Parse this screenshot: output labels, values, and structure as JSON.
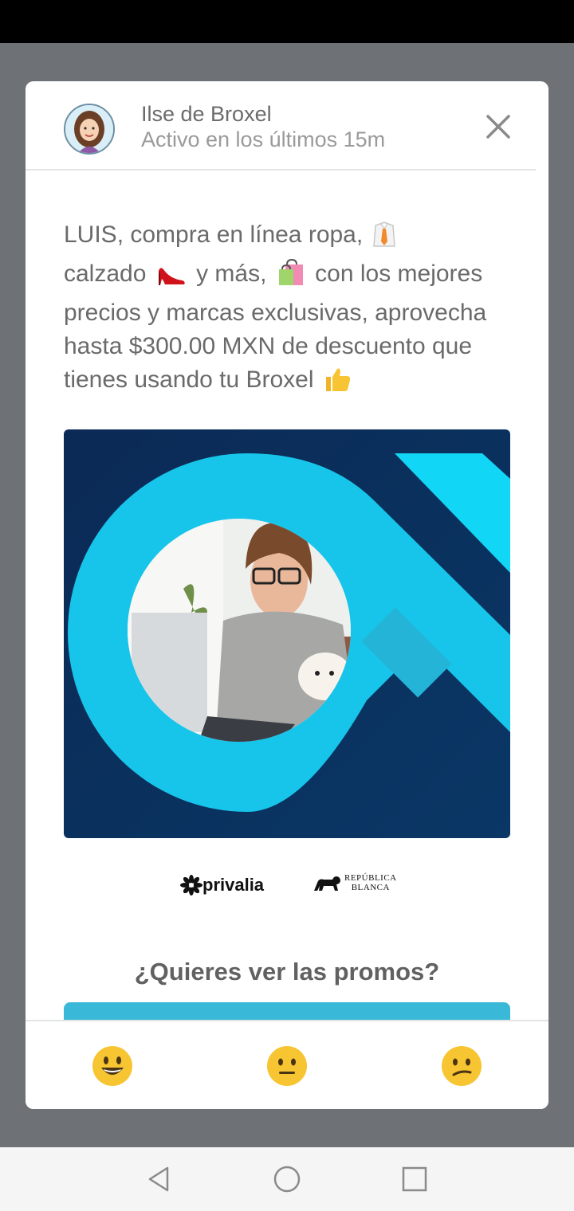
{
  "sender": {
    "name": "Ilse de Broxel",
    "status": "Activo en los últimos 15m"
  },
  "message": {
    "part1": "LUIS, compra en línea ropa,",
    "part2": "calzado",
    "part3": "y más,",
    "part4": "con los mejores precios y marcas exclusivas, aprove­cha hasta $300.00 MXN de descuento que tienes usando tu Broxel"
  },
  "brands": {
    "privalia": "privalia",
    "republica_line1": "República",
    "republica_line2": "Blanca"
  },
  "promo": {
    "question": "¿Quieres ver las promos?"
  },
  "icons": {
    "close": "close-icon",
    "shirt": "shirt-tie-emoji",
    "shoe": "high-heel-emoji",
    "bag": "shopping-bags-emoji",
    "thumbs": "thumbs-up-emoji",
    "reactions": [
      "grinning-face-icon",
      "neutral-face-icon",
      "confused-face-icon"
    ],
    "nav": [
      "back-icon",
      "home-icon",
      "recents-icon"
    ]
  },
  "colors": {
    "accent": "#3ab8d8",
    "image_bg": "#0b2f5c",
    "image_ring": "#18c8ee"
  }
}
